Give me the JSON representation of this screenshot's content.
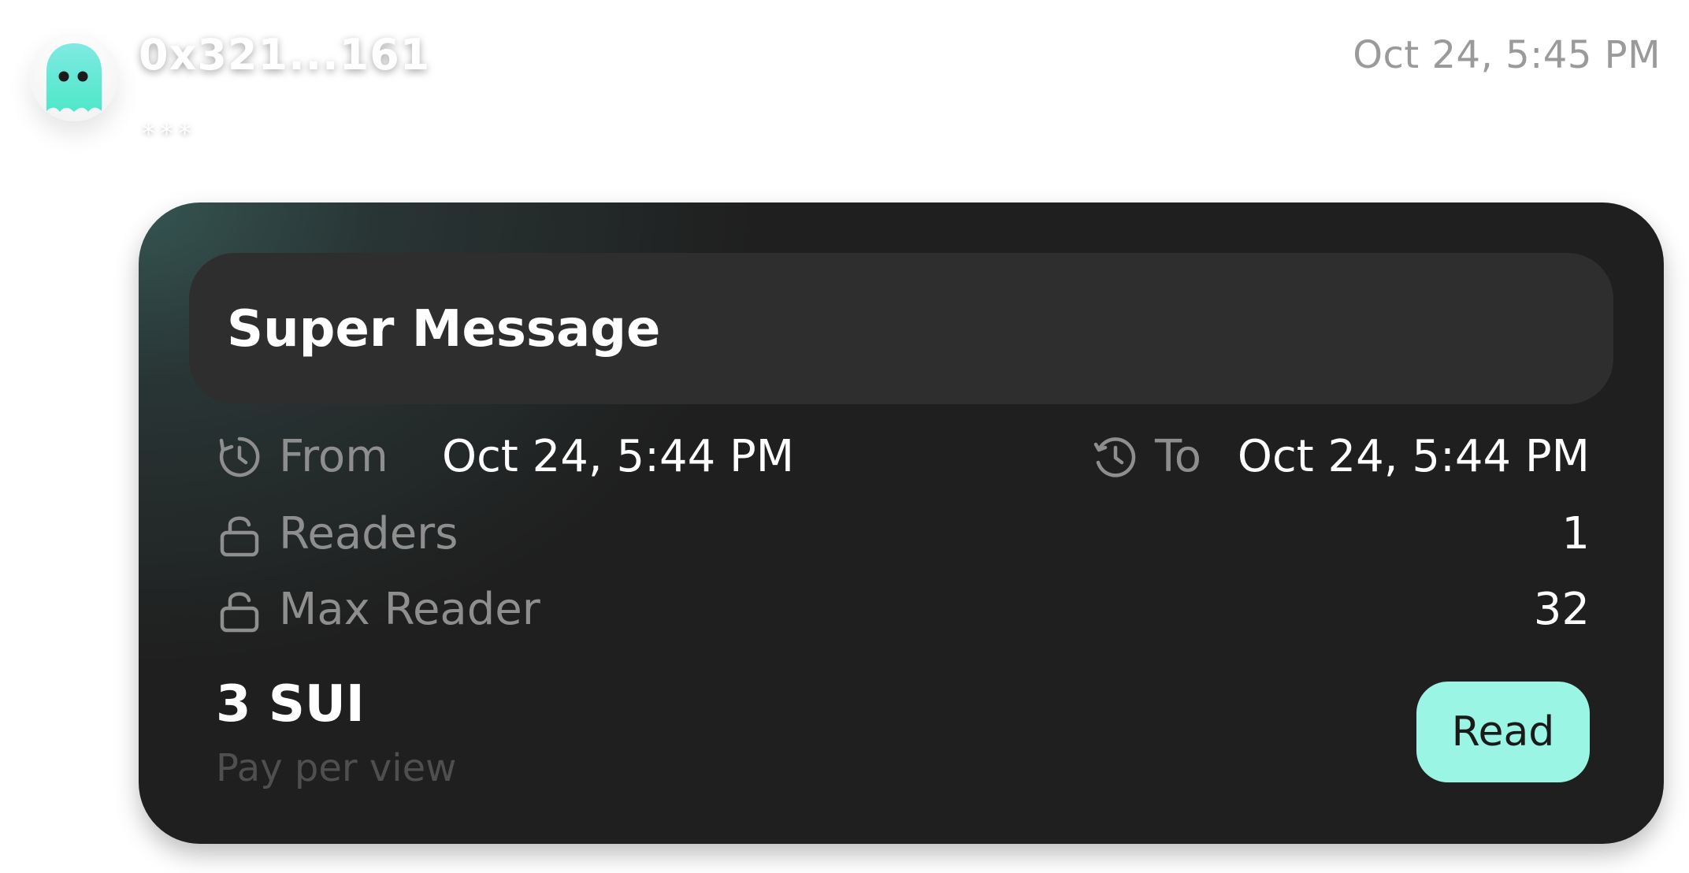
{
  "message": {
    "sender": "0x321...161",
    "sender_sub": "***",
    "timestamp": "Oct 24,  5:45 PM",
    "avatar_icon": "ghost-icon"
  },
  "card": {
    "title": "Super Message",
    "from_label": "From",
    "from_value": "Oct 24, 5:44 PM",
    "to_label": "To",
    "to_value": "Oct 24, 5:44 PM",
    "readers_label": "Readers",
    "readers_value": "1",
    "max_reader_label": "Max Reader",
    "max_reader_value": "32",
    "price": "3 SUI",
    "price_sub": "Pay per view",
    "read_button": "Read"
  },
  "colors": {
    "accent": "#9bf5e4",
    "card_bg": "#1f1f1f",
    "title_bar_bg": "#2e2e2e",
    "muted_text": "#8e8e8e"
  }
}
